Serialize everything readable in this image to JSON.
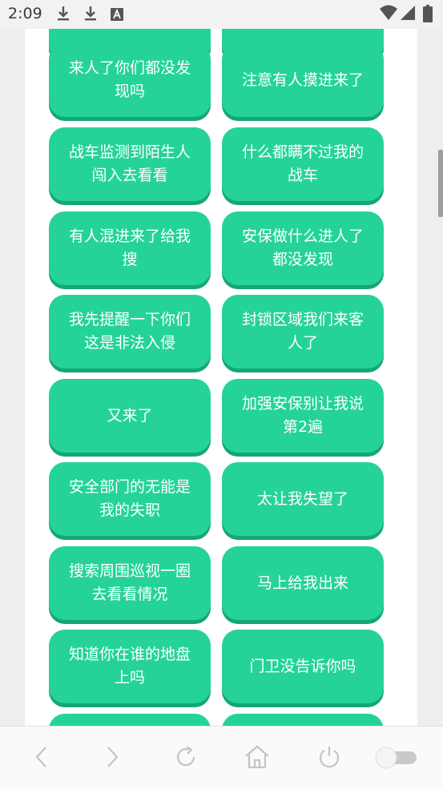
{
  "status_bar": {
    "time": "2:09",
    "icons": [
      "download-icon",
      "download-icon",
      "font-icon",
      "wifi-icon",
      "signal-icon",
      "battery-icon"
    ]
  },
  "buttons": [
    {
      "label": ""
    },
    {
      "label": ""
    },
    {
      "label": "来人了你们都没发现吗"
    },
    {
      "label": "注意有人摸进来了"
    },
    {
      "label": "战车监测到陌生人闯入去看看"
    },
    {
      "label": "什么都瞒不过我的战车"
    },
    {
      "label": "有人混进来了给我搜"
    },
    {
      "label": "安保做什么进人了都没发现"
    },
    {
      "label": "我先提醒一下你们这是非法入侵"
    },
    {
      "label": "封锁区域我们来客人了"
    },
    {
      "label": "又来了"
    },
    {
      "label": "加强安保别让我说第2遍"
    },
    {
      "label": "安全部门的无能是我的失职"
    },
    {
      "label": "太让我失望了"
    },
    {
      "label": "搜索周围巡视一圈去看看情况"
    },
    {
      "label": "马上给我出来"
    },
    {
      "label": "知道你在谁的地盘上吗"
    },
    {
      "label": "门卫没告诉你吗"
    },
    {
      "label": ""
    },
    {
      "label": ""
    }
  ],
  "nav": {
    "icons": [
      "back-icon",
      "forward-icon",
      "refresh-icon",
      "home-icon",
      "power-icon",
      "toggle-switch"
    ]
  },
  "colors": {
    "button": "#25d39a",
    "button_shadow": "#16a676",
    "page_bg": "#eeeeee"
  }
}
